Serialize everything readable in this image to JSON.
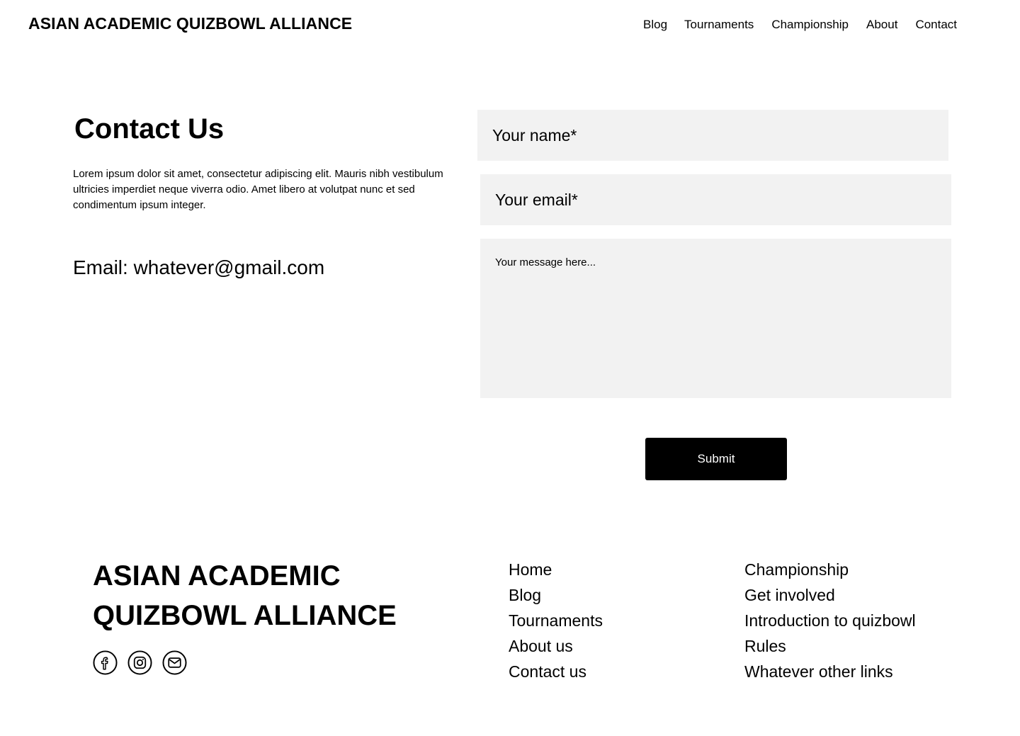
{
  "header": {
    "site_title": "ASIAN ACADEMIC QUIZBOWL ALLIANCE",
    "nav": [
      "Blog",
      "Tournaments",
      "Championship",
      "About",
      "Contact"
    ]
  },
  "contact": {
    "heading": "Contact Us",
    "description": "Lorem ipsum dolor sit amet, consectetur adipiscing elit. Mauris nibh vestibulum ultricies imperdiet neque viverra odio. Amet libero at volutpat nunc et sed condimentum ipsum integer.",
    "email_text": "Email: whatever@gmail.com"
  },
  "form": {
    "name_placeholder": "Your name*",
    "email_placeholder": "Your email*",
    "message_placeholder": "Your message here...",
    "submit_label": "Submit"
  },
  "footer": {
    "brand": "ASIAN ACADEMIC QUIZBOWL ALLIANCE",
    "social_icons": [
      "facebook-icon",
      "instagram-icon",
      "email-icon"
    ],
    "links_col1": [
      "Home",
      "Blog",
      "Tournaments",
      "About us",
      "Contact us"
    ],
    "links_col2": [
      "Championship",
      "Get involved",
      "Introduction to quizbowl",
      "Rules",
      "Whatever other links"
    ]
  }
}
